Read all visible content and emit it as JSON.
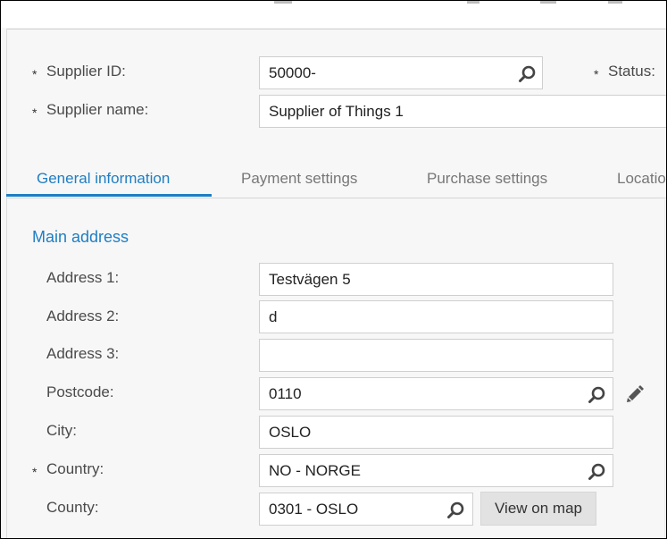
{
  "header": {
    "supplier_id": {
      "label": "Supplier ID:",
      "value": "50000-"
    },
    "status": {
      "label": "Status:"
    },
    "supplier_name": {
      "label": "Supplier name:",
      "value": "Supplier of Things 1"
    },
    "required_marker": "*"
  },
  "tabs": [
    {
      "label": "General information",
      "active": true
    },
    {
      "label": "Payment settings",
      "active": false
    },
    {
      "label": "Purchase settings",
      "active": false
    },
    {
      "label": "Locatio",
      "active": false
    }
  ],
  "main_address": {
    "title": "Main address",
    "address1": {
      "label": "Address 1:",
      "value": "Testvägen 5"
    },
    "address2": {
      "label": "Address 2:",
      "value": "d"
    },
    "address3": {
      "label": "Address 3:",
      "value": ""
    },
    "postcode": {
      "label": "Postcode:",
      "value": "0110"
    },
    "city": {
      "label": "City:",
      "value": "OSLO"
    },
    "country": {
      "label": "Country:",
      "value": "NO - NORGE"
    },
    "county": {
      "label": "County:",
      "value": "0301 - OSLO"
    },
    "view_on_map": "View on map"
  },
  "icons": {
    "search": "search-icon",
    "edit": "pencil-icon"
  },
  "colors": {
    "accent": "#1f7ec2",
    "label": "#4a4a4a",
    "border": "#cfcfcf",
    "button_bg": "#e2e2e2"
  }
}
